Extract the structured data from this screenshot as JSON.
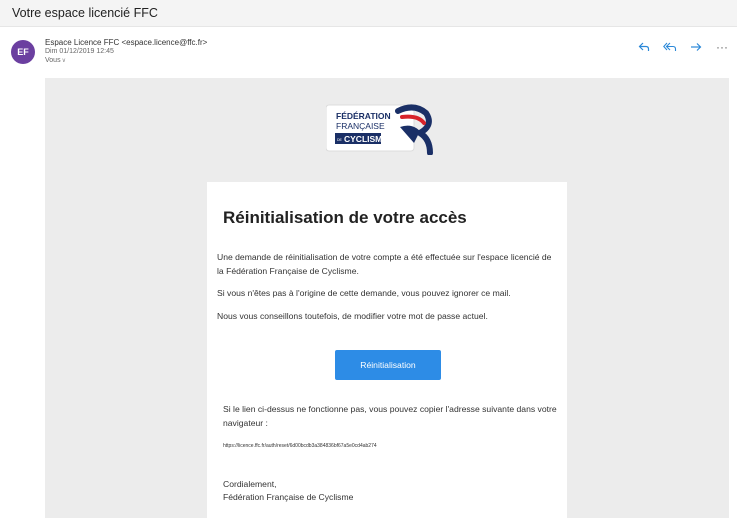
{
  "header": {
    "subject": "Votre espace licencié FFC"
  },
  "message": {
    "avatar_initials": "EF",
    "sender": "Espace Licence FFC <espace.licence@ffc.fr>",
    "date": "Dim 01/12/2019 12:45",
    "to": "Vous"
  },
  "actions": {
    "icons": [
      "reply-icon",
      "reply-all-icon",
      "forward-icon",
      "more-icon"
    ],
    "more_glyph": "···"
  },
  "email": {
    "logo": {
      "line1": "FÉDÉRATION",
      "line2": "FRANÇAISE",
      "line3": "CYCLISME",
      "prefix": "DE"
    },
    "title": "Réinitialisation de votre accès",
    "paragraphs": [
      "Une demande de réinitialisation de votre compte a été effectuée sur l'espace licencié de la Fédération Française de Cyclisme.",
      "Si vous n'êtes pas à l'origine de cette demande, vous pouvez ignorer ce mail.",
      "Nous vous conseillons toutefois, de modifier votre mot de passe actuel."
    ],
    "button_label": "Réinitialisation",
    "hint": "Si le lien ci-dessus ne fonctionne pas, vous pouvez copier l'adresse suivante dans votre navigateur :",
    "url": "https://licence.ffc.fr/auth/reset/6d00bcdb3a384836bf67a5e0cd4ab274",
    "closing": "Cordialement,",
    "signature": "Fédération Française de Cyclisme"
  },
  "colors": {
    "accent": "#2d8ce6",
    "avatar": "#6b3fa0",
    "logo_navy": "#1a2f66",
    "logo_red": "#d8232a"
  }
}
